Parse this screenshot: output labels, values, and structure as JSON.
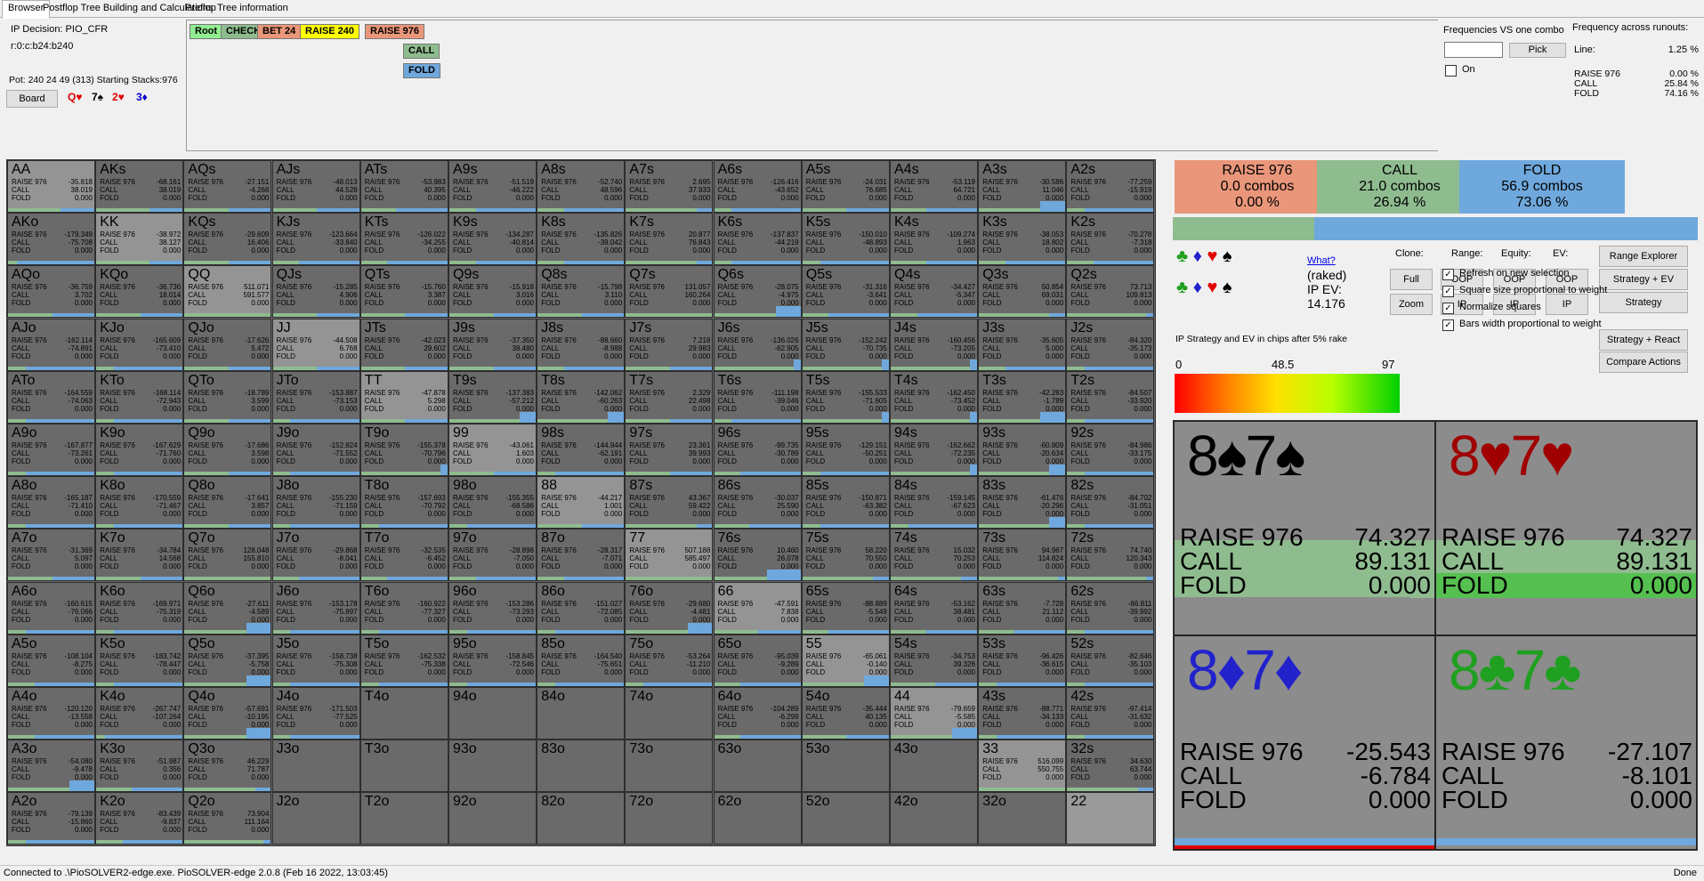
{
  "tabs": [
    "Browser",
    "Postflop Tree Building and Calculations",
    "Preflop",
    "Tree information"
  ],
  "info": {
    "decision": "IP Decision:  PIO_CFR",
    "line": "r:0:c:b24:b240",
    "board_label": "Board",
    "board_cards": [
      {
        "t": "Q♥",
        "c": "#e00000"
      },
      {
        "t": "7♠",
        "c": "#000000"
      },
      {
        "t": "2♥",
        "c": "#e00000"
      },
      {
        "t": "3♦",
        "c": "#0000cc"
      }
    ],
    "pot": "Pot: 240 24 49 (313) Starting Stacks:976"
  },
  "tree": [
    {
      "label": "Root",
      "bg": "#90ee90"
    },
    {
      "label": "CHECK",
      "bg": "#8fbc8f"
    },
    {
      "label": "BET 24",
      "bg": "#e9967a"
    },
    {
      "label": "RAISE 240",
      "bg": "#ffff00"
    },
    {
      "label": "RAISE 976",
      "bg": "#e9967a"
    }
  ],
  "tree_sub": [
    {
      "label": "CALL",
      "bg": "#8fbc8f"
    },
    {
      "label": "FOLD",
      "bg": "#6fa8dc"
    }
  ],
  "freq": {
    "title": "Frequencies VS one combo",
    "pick": "Pick",
    "on": "On"
  },
  "runouts": {
    "title": "Frequency across runouts:",
    "line_label": "Line:",
    "line_value": "1.25 %",
    "rows": [
      {
        "k": "RAISE 976",
        "v": "0.00 %"
      },
      {
        "k": "CALL",
        "v": "25.84 %"
      },
      {
        "k": "FOLD",
        "v": "74.16 %"
      }
    ]
  },
  "summary": [
    {
      "title": "RAISE 976",
      "combos": "0.0 combos",
      "pct": "0.00 %",
      "bg": "#e9967a"
    },
    {
      "title": "CALL",
      "combos": "21.0 combos",
      "pct": "26.94 %",
      "bg": "#8fbc8f"
    },
    {
      "title": "FOLD",
      "combos": "56.9 combos",
      "pct": "73.06 %",
      "bg": "#6fa8dc"
    }
  ],
  "strat_bar": {
    "call": 26.94,
    "fold": 73.06,
    "call_color": "#8fbc8f",
    "fold_color": "#6fa8dc"
  },
  "clone": {
    "what": "What?",
    "raked": "(raked)",
    "ipev_label": "IP EV:",
    "ipev": "14.176",
    "clone": "Clone:",
    "range": "Range:",
    "equity": "Equity:",
    "ev": "EV:",
    "full": "Full",
    "zoom": "Zoom",
    "oop": "OOP",
    "ip": "IP"
  },
  "right_buttons": [
    "Range Explorer",
    "Strategy + EV",
    "Strategy",
    "Strategy + React",
    "Compare Actions"
  ],
  "checks": [
    "Refresh on new selection",
    "Square size proportional to weight",
    "Normalize squares",
    "Bars width proportional to weight"
  ],
  "legend": {
    "title": "IP Strategy and EV in chips after 5% rake",
    "min": "0",
    "mid": "48.5",
    "max": "97"
  },
  "combos": [
    {
      "name": "8♠7♠",
      "color": "#000000",
      "r": "74.327",
      "c": "89.131",
      "f": "0.000",
      "call_pct": 0.9
    },
    {
      "name": "8♥7♥",
      "color": "#a00000",
      "r": "74.327",
      "c": "89.131",
      "f": "0.000",
      "call_pct": 1.0
    },
    {
      "name": "8♦7♦",
      "color": "#2222cc",
      "r": "-25.543",
      "c": "-6.784",
      "f": "0.000",
      "call_pct": 0.0
    },
    {
      "name": "8♣7♣",
      "color": "#20a020",
      "r": "-27.107",
      "c": "-8.101",
      "f": "0.000",
      "call_pct": 0.0
    }
  ],
  "rows": [
    [
      "AA:-35.818:38.019:0.000:0.6:n",
      "AKs:-68.161:38.019:0.000:0.6:n",
      "AQs:-27.151:-4.268:0.000:0.5:n",
      "AJs:-48.013:44.528:0.000:0.5:n",
      "ATs:-53.983:40.395:0.000:0.4:n",
      "A9s:-51.519:-46.222:0.000:0.3:n",
      "A8s:-52.740:48.596:0.000:0.3:n",
      "A7s:2.695:37.933:0.000:0.8:n",
      "A6s:-126.416:-43.652:0.000:0.2:n",
      "A5s:-24.031:76.685:0.000:0.5:n",
      "A4s:-53.119:64.721:0.000:0.4:n",
      "A3s:-30.586:11.046:0.000:0.3:f",
      "A2s:-77.259:-15.919:0.000:0.2:n"
    ],
    [
      "AKo:-179.349:-75.708:0.000:0.1:n",
      "KK:-38.972:38.127:0.000:0.6:n",
      "KQs:-29.609:16.406:0.000:0.5:n",
      "KJs:-123.664:-33.840:0.000:0.3:n",
      "KTs:-126.022:-34.255:0.000:0.3:n",
      "K9s:-134.287:-40.814:0.000:0.3:n",
      "K8s:-135.826:-39.042:0.000:0.3:n",
      "K7s:20.877:76.843:0.000:0.8:n",
      "K6s:-137.837:-44.219:0.000:0.2:n",
      "K5s:-150.010:-48.893:0.000:0.2:n",
      "K4s:-109.274:1.963:0.000:0.4:n",
      "K3s:-38.053:18.802:0.000:0.3:n",
      "K2s:-70.278:-7.318:0.000:0.3:n"
    ],
    [
      "AQo:-36.759:3.702:0.000:0.5:n",
      "KQo:-36.736:18.014:0.000:0.5:n",
      "QQ:511.071:591.577:0.000:1.0:n",
      "QJs:-15.285:4.906:0.000:0.5:n",
      "QTs:-15.760:3.387:0.000:0.5:n",
      "Q9s:-15.918:3.016:0.000:0.5:n",
      "Q8s:-15.798:3.110:0.000:0.5:n",
      "Q7s:131.057:160.264:0.000:1.0:n",
      "Q6s:-28.075:-4.975:0.000:0.3:f",
      "Q5s:-31.316:-3.641:0.000:0.3:n",
      "Q4s:-34.427:-5.347:0.000:0.3:n",
      "Q3s:50.854:69.031:0.000:0.8:n",
      "Q2s:73.713:109.813:0.000:0.9:n"
    ],
    [
      "AJo:-162.114:-74.891:0.000:0.2:n",
      "KJo:-165.609:-73.410:0.000:0.2:n",
      "QJo:-17.626:5.472:0.000:0.5:n",
      "JJ:-44.508:6.768:0.000:0.5:n",
      "JTs:-42.023:29.602:0.000:0.5:n",
      "J9s:-37.350:38.480:0.000:0.5:n",
      "J8s:-88.660:-8.988:0.000:0.3:n",
      "J7s:7.218:29.983:0.000:0.5:n",
      "J6s:-136.026:-62.905:0.000:0.1:f",
      "J5s:-152.242:-70.735:0.000:0.1:f",
      "J4s:-160.456:-73.205:0.000:0.1:f",
      "J3s:-35.605:5.000:0.000:0.3:n",
      "J2s:-84.320:-35.173:0.000:0.2:n"
    ],
    [
      "ATo:-164.559:-74.063:0.000:0.2:n",
      "KTo:-168.114:-72.943:0.000:0.2:n",
      "QTo:-18.789:3.599:0.000:0.5:n",
      "JTo:-153.887:-73.153:0.000:0.2:n",
      "TT:-47.878:5.298:0.000:0.5:n",
      "T9s:-137.383:-57.212:0.000:0.2:f",
      "T8s:-142.062:-60.263:0.000:0.2:f",
      "T7s:2.329:22.498:0.000:0.5:n",
      "T6s:-111.198:-39.046:0.000:0.2:n",
      "T5s:-155.533:-71.605:0.000:0.1:f",
      "T4s:-162.450:-73.452:0.000:0.1:f",
      "T3s:-42.283:-1.789:0.000:0.3:f",
      "T2s:-84.507:-33.920:0.000:0.2:n"
    ],
    [
      "A9o:-167.877:-73.261:0.000:0.2:n",
      "K9o:-167.629:-71.760:0.000:0.2:n",
      "Q9o:-17.686:3.598:0.000:0.5:n",
      "J9o:-152.824:-71.552:0.000:0.2:n",
      "T9o:-155.378:-70.796:0.000:0.1:f",
      "99:-43.061:1.603:0.000:0.5:n",
      "98s:-144.944:-62.191:0.000:0.2:n",
      "97s:23.361:39.993:0.000:0.5:n",
      "96s:-99.735:-30.789:0.000:0.3:n",
      "95s:-129.151:-50.251:0.000:0.2:n",
      "94s:-162.662:-72.235:0.000:0.1:f",
      "93s:-60.809:-20.634:0.000:0.2:f",
      "92s:-84.986:-33.175:0.000:0.2:n"
    ],
    [
      "A8o:-165.187:-71.410:0.000:0.2:n",
      "K8o:-170.559:-71.467:0.000:0.2:n",
      "Q8o:-17.641:3.857:0.000:0.5:n",
      "J8o:-155.230:-71.159:0.000:0.2:n",
      "T8o:-157.693:-70.792:0.000:0.2:n",
      "98o:-155.355:-68.586:0.000:0.2:n",
      "88:-44.217:1.001:0.000:0.5:n",
      "87s:43.367:59.422:0.000:0.8:n",
      "86s:-30.037:25.590:0.000:0.4:n",
      "85s:-150.871:-63.382:0.000:0.2:n",
      "84s:-159.145:-67.623:0.000:0.2:n",
      "83s:-61.476:-20.296:0.000:0.2:f",
      "82s:-84.702:-31.051:0.000:0.2:n"
    ],
    [
      "A7o:-31.369:5.097:0.000:0.5:n",
      "K7o:-34.784:14.568:0.000:0.5:n",
      "Q7o:128.048:155.810:0.000:1.0:n",
      "J7o:-29.868:-8.041:0.000:0.3:n",
      "T7o:-32.535:-6.452:0.000:0.3:n",
      "97o:-28.898:-7.050:0.000:0.3:n",
      "87o:-28.317:-7.071:0.000:0.3:n",
      "77:507.188:585.497:0.000:1.0:n",
      "76s:10.460:26.078:0.000:0.4:f",
      "75s:58.220:70.550:0.000:0.8:n",
      "74s:15.032:70.253:0.000:0.8:n",
      "73s:94.967:114.824:0.000:0.9:n",
      "72s:74.740:120.343:0.000:0.9:n"
    ],
    [
      "A6o:-160.615:-76.066:0.000:0.2:n",
      "K6o:-169.971:-75.319:0.000:0.2:n",
      "Q6o:-27.611:-4.589:0.000:0.3:f",
      "J6o:-153.178:-75.897:0.000:0.2:n",
      "T6o:-160.922:-77.327:0.000:0.2:n",
      "96o:-153.286:-73.293:0.000:0.2:n",
      "86o:-151.027:-72.085:0.000:0.2:n",
      "76o:-29.680:-4.481:0.000:0.3:f",
      "66:-47.591:7.838:0.000:0.5:n",
      "65s:-88.889:-5.549:0.000:0.3:n",
      "64s:-53.162:38.481:0.000:0.4:n",
      "63s:-7.728:21.112:0.000:0.4:n",
      "62s:-86.811:-39.992:0.000:0.2:n"
    ],
    [
      "A5o:-108.104:-8.275:0.000:0.3:n",
      "K5o:-183.742:-78.447:0.000:0.2:n",
      "Q5o:-37.395:-5.758:0.000:0.3:f",
      "J5o:-158.738:-75.308:0.000:0.2:n",
      "T5o:-162.532:-75.338:0.000:0.2:n",
      "95o:-158.845:-72.546:0.000:0.2:n",
      "85o:-164.540:-75.651:0.000:0.2:n",
      "75o:-53.264:-11.210:0.000:0.2:n",
      "65o:-95.039:-9.289:0.000:0.3:n",
      "55:-65.061:-0.140:0.000:0.3:f",
      "54s:-34.753:39.326:0.000:0.5:n",
      "53s:-96.426:-36.615:0.000:0.2:n",
      "52s:-82.646:-35.103:0.000:0.2:n"
    ],
    [
      "A4o:-120.120:-13.558:0.000:0.3:n",
      "K4o:-267.747:-107.264:0.000:0.1:n",
      "Q4o:-57.691:-10.195:0.000:0.3:f",
      "J4o:-171.503:-77.525:0.000:0.2:n",
      "T4o:::::e",
      "94o:::::e",
      "84o:::::e",
      "74o:::::e",
      "64o:-104.289:-6.299:0.000:0.3:n",
      "54o:-35.444:40.135:0.000:0.5:n",
      "44:-79.659:-5.585:0.000:0.3:f",
      "43s:-88.771:-34.133:0.000:0.2:n",
      "42s:-97.414:-31.632:0.000:0.2:n"
    ],
    [
      "A3o:-54.080:-9.478:0.000:0.3:f",
      "K3o:-51.987:0.356:0.000:0.4:n",
      "Q3o:46.229:71.787:0.000:0.8:n",
      "J3o:::::e",
      "T3o:::::e",
      "93o:::::e",
      "83o:::::e",
      "73o:::::e",
      "63o:::::e",
      "53o:::::e",
      "43o:::::e",
      "33:516.099:550.755:0.000:1.0:n",
      "32s:34.630:63.744:0.000:0.8:n"
    ],
    [
      "A2o:-79.139:-15.860:0.000:0.2:n",
      "K2o:-83.439:-9.837:0.000:0.3:n",
      "Q2o:73.904:111.164:0.000:0.9:n",
      "J2o:::::e",
      "T2o:::::e",
      "92o:::::e",
      "82o:::::e",
      "72o:::::e",
      "62o:::::e",
      "52o:::::e",
      "42o:::::e",
      "32o:::::e",
      "22:::::e"
    ]
  ],
  "status": "Connected to .\\PioSOLVER2-edge.exe. PioSOLVER-edge 2.0.8 (Feb 16 2022, 13:03:45)",
  "status_right": "Done",
  "colors": {
    "call": "#8fbc8f",
    "fold": "#6fa8dc",
    "raise": "#e9967a"
  }
}
